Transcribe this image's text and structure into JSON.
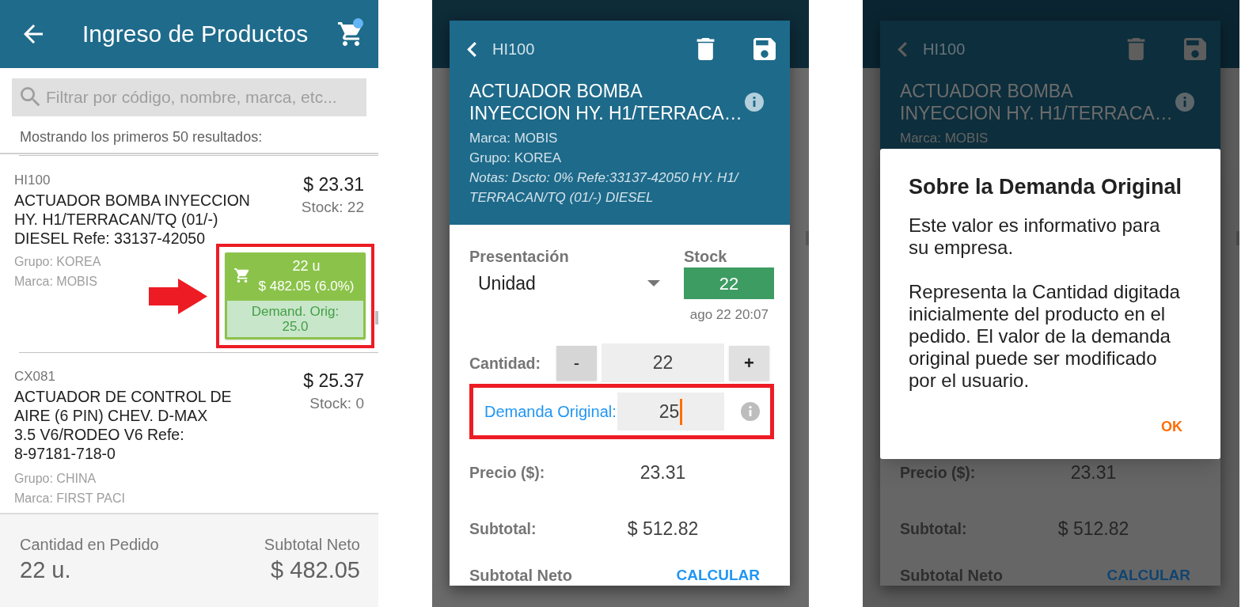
{
  "list_screen": {
    "app_bar": {
      "title": "Ingreso de Productos",
      "cart_badge": true
    },
    "search": {
      "placeholder": "Filtrar por código, nombre, marca, etc..."
    },
    "results_note": "Mostrando los primeros 50 resultados:",
    "products": [
      {
        "code": "HI100",
        "name": "ACTUADOR BOMBA INYECCION\nHY. H1/TERRACAN/TQ (01/-)\nDIESEL Refe: 33137-42050",
        "price": "$ 23.31",
        "stock": "Stock: 22",
        "group": "Grupo: KOREA",
        "brand": "Marca: MOBIS",
        "order": {
          "quantity": "22 u",
          "amount": "$ 482.05 (6.0%)",
          "original_demand": "Demand. Orig: 25.0",
          "highlighted": true,
          "arrow": true
        }
      },
      {
        "code": "CX081",
        "name": "ACTUADOR DE CONTROL DE\nAIRE (6 PIN) CHEV. D-MAX\n3.5 V6/RODEO V6 Refe:\n8-97181-718-0",
        "price": "$ 25.37",
        "stock": "Stock: 0",
        "group": "Grupo: CHINA",
        "brand": "Marca: FIRST PACI"
      }
    ],
    "footer": {
      "quantity_label": "Cantidad en Pedido",
      "quantity": "22 u.",
      "subtotal_label": "Subtotal Neto",
      "subtotal": "$ 482.05"
    }
  },
  "edit_screen": {
    "dialog": {
      "dimmed": false,
      "code": "HI100",
      "title": "ACTUADOR BOMBA\nINYECCION HY. H1/TERRACA…",
      "brand": "Marca: MOBIS",
      "group": "Grupo: KOREA",
      "notes": "Notas: Dscto: 0% Refe:33137-42050 HY. H1/\nTERRACAN/TQ (01/-) DIESEL",
      "presentation": {
        "label": "Presentación",
        "value": "Unidad"
      },
      "stock": {
        "label": "Stock",
        "value": "22",
        "updated": "ago 22 20:07"
      },
      "quantity": {
        "label": "Cantidad:",
        "decrement": "-",
        "value": "22",
        "increment": "+"
      },
      "original_demand": {
        "label": "Demanda Original:",
        "value": "25",
        "focused": true,
        "highlighted": true
      },
      "price": {
        "label": "Precio ($):",
        "value": "23.31"
      },
      "subtotal": {
        "label": "Subtotal:",
        "value": "$ 512.82"
      },
      "net_subtotal": {
        "label": "Subtotal Neto",
        "action": "CALCULAR"
      }
    }
  },
  "info_screen": {
    "dialog": {
      "dimmed": true,
      "code": "HI100",
      "title": "ACTUADOR BOMBA\nINYECCION HY. H1/TERRACA…",
      "brand": "Marca: MOBIS",
      "price": {
        "label": "Precio ($):",
        "value": "23.31"
      },
      "subtotal": {
        "label": "Subtotal:",
        "value": "$ 512.82"
      },
      "net_subtotal": {
        "label": "Subtotal Neto",
        "action": "CALCULAR"
      }
    },
    "alert": {
      "title": "Sobre la Demanda Original",
      "paragraphs": [
        "Este valor es informativo para\nsu empresa.",
        "Representa la Cantidad digitada\ninicialmente del producto en el\npedido. El valor de la demanda\noriginal puede ser modificado\npor el usuario."
      ],
      "button": "OK"
    }
  }
}
